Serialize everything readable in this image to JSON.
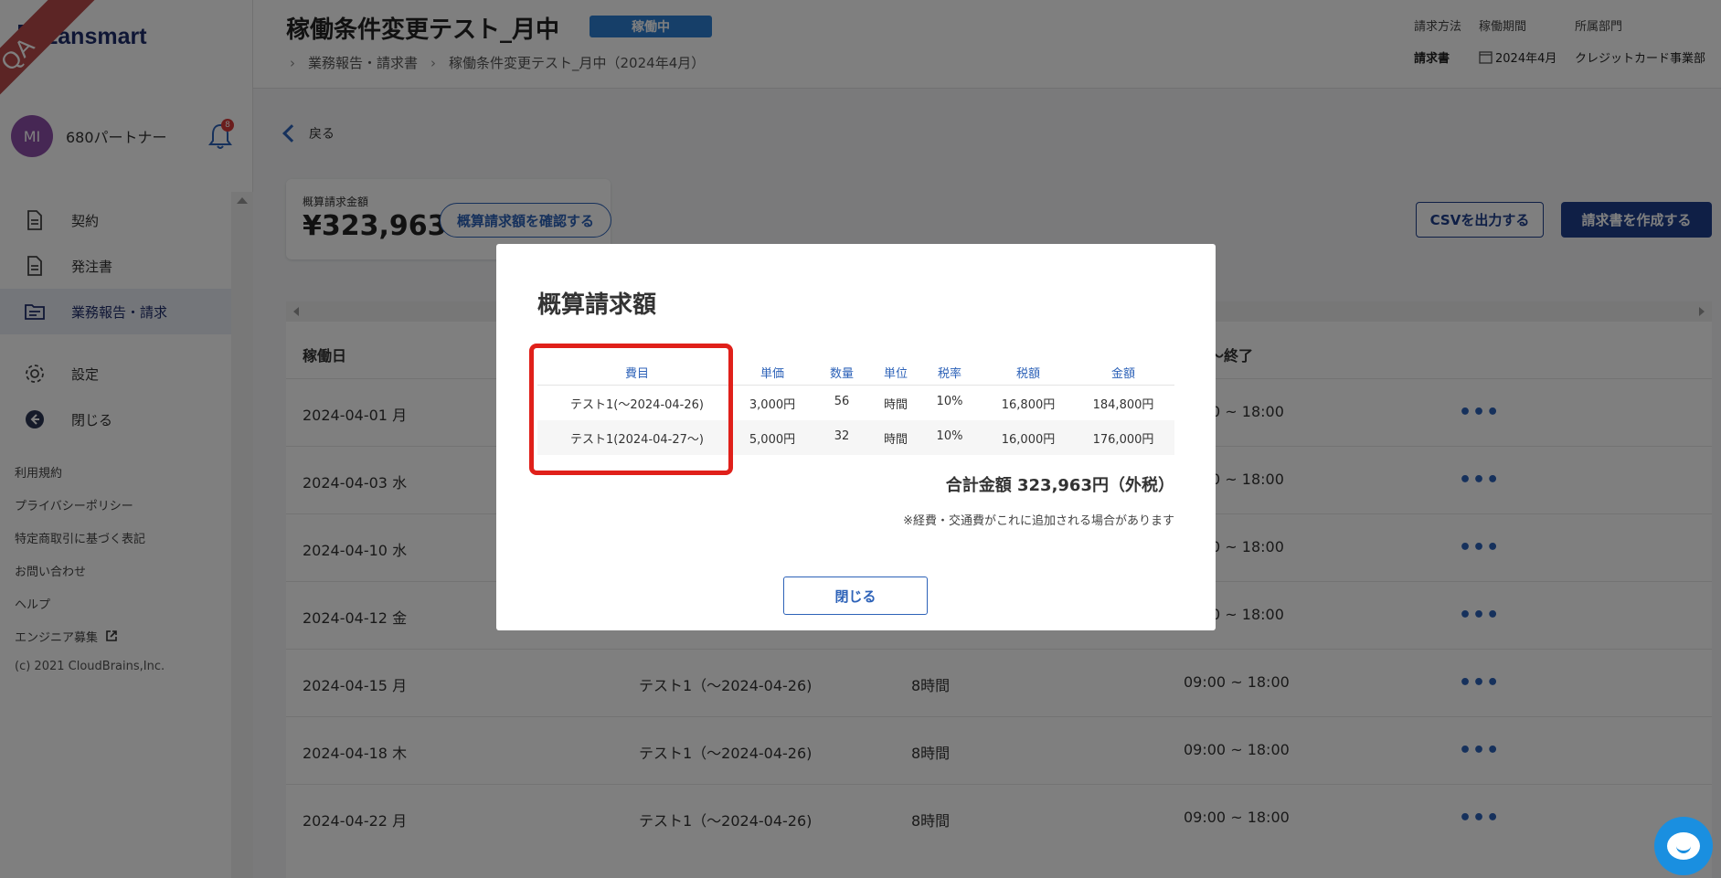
{
  "sidebar": {
    "qa_ribbon": "QA",
    "logo": "Lansmart",
    "user": {
      "initials": "MI",
      "name": "680パートナー",
      "notification_count": "8"
    },
    "nav": [
      {
        "label": "契約"
      },
      {
        "label": "発注書"
      },
      {
        "label": "業務報告・請求"
      },
      {
        "label": "設定"
      },
      {
        "label": "閉じる"
      }
    ],
    "links": [
      "利用規約",
      "プライバシーポリシー",
      "特定商取引に基づく表記",
      "お問い合わせ",
      "ヘルプ",
      "エンジニア募集"
    ],
    "copyright": "(c) 2021 CloudBrains,Inc."
  },
  "header": {
    "title": "稼働条件変更テスト_月中",
    "status": "稼働中",
    "breadcrumb": [
      "業務報告・請求書",
      "稼働条件変更テスト_月中（2024年4月）"
    ],
    "meta": [
      {
        "label": "請求方法",
        "value": "請求書"
      },
      {
        "label": "稼働期間",
        "value": "2024年4月"
      },
      {
        "label": "所属部門",
        "value": "クレジットカード事業部"
      }
    ]
  },
  "main": {
    "back_label": "戻る",
    "estimate_label": "概算請求金額",
    "estimate_value": "¥323,963",
    "confirm_button": "概算請求額を確認する",
    "csv_button": "CSVを出力する",
    "invoice_button": "請求書を作成する",
    "table": {
      "headers": [
        "稼働日",
        "〜終了"
      ],
      "rows": [
        {
          "date": "2024-04-01 月",
          "item": "",
          "hours": "",
          "time": "0 ~ 18:00"
        },
        {
          "date": "2024-04-03 水",
          "item": "",
          "hours": "",
          "time": "0 ~ 18:00"
        },
        {
          "date": "2024-04-10 水",
          "item": "",
          "hours": "",
          "time": "0 ~ 18:00"
        },
        {
          "date": "2024-04-12 金",
          "item": "",
          "hours": "",
          "time": "0 ~ 18:00"
        },
        {
          "date": "2024-04-15 月",
          "item": "テスト1（〜2024-04-26)",
          "hours": "8時間",
          "time": "09:00 ~ 18:00"
        },
        {
          "date": "2024-04-18 木",
          "item": "テスト1（〜2024-04-26)",
          "hours": "8時間",
          "time": "09:00 ~ 18:00"
        },
        {
          "date": "2024-04-22 月",
          "item": "テスト1（〜2024-04-26)",
          "hours": "8時間",
          "time": "09:00 ~ 18:00"
        }
      ],
      "more_label": "•••"
    }
  },
  "modal": {
    "title": "概算請求額",
    "columns": [
      "費目",
      "単価",
      "数量",
      "単位",
      "税率",
      "税額",
      "金額"
    ],
    "rows": [
      [
        "テスト1(〜2024-04-26)",
        "3,000円",
        "56",
        "時間",
        "10%",
        "16,800円",
        "184,800円"
      ],
      [
        "テスト1(2024-04-27〜)",
        "5,000円",
        "32",
        "時間",
        "10%",
        "16,000円",
        "176,000円"
      ]
    ],
    "total": "合計金額  323,963円（外税）",
    "note": "※経費・交通費がこれに追加される場合があります",
    "close_button": "閉じる"
  },
  "colors": {
    "accent": "#2d62b8",
    "brand": "#1e3f8c",
    "highlight": "#e0201a"
  }
}
